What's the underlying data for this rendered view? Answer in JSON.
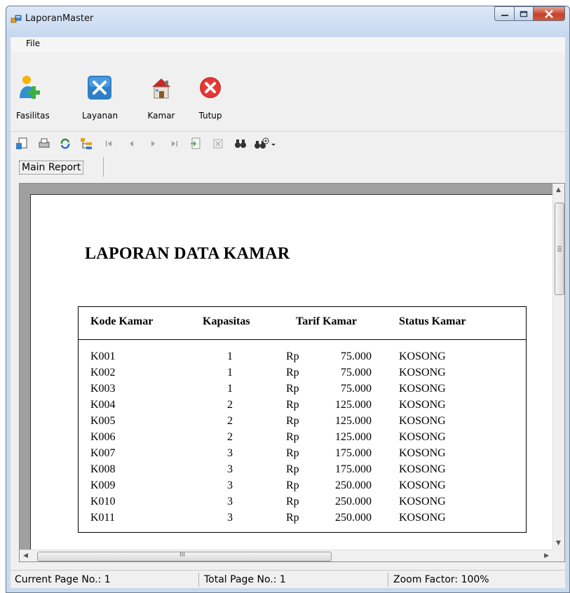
{
  "window": {
    "title": "LaporanMaster",
    "minimize": "–",
    "maximize": "□",
    "close": "✕"
  },
  "menu": {
    "file": "File"
  },
  "toolstrip": {
    "buttons": [
      {
        "label": "Fasilitas",
        "icon": "add-user-icon"
      },
      {
        "label": "Layanan",
        "icon": "tools-icon"
      },
      {
        "label": "Kamar",
        "icon": "house-icon"
      },
      {
        "label": "Tutup",
        "icon": "close-circle-icon"
      }
    ]
  },
  "viewer_toolbar": {
    "icons": [
      "export-icon",
      "print-icon",
      "refresh-icon",
      "group-tree-icon",
      "first-page-icon",
      "prev-page-icon",
      "next-page-icon",
      "last-page-icon",
      "goto-page-icon",
      "stop-icon",
      "search-icon",
      "zoom-icon"
    ]
  },
  "tab": {
    "label": "Main Report"
  },
  "report": {
    "title": "LAPORAN DATA KAMAR",
    "columns": [
      "Kode Kamar",
      "Kapasitas",
      "Tarif Kamar",
      "Status Kamar"
    ],
    "currency": "Rp",
    "rows": [
      {
        "kode": "K001",
        "kapasitas": "1",
        "tarif": "75.000",
        "status": "KOSONG"
      },
      {
        "kode": "K002",
        "kapasitas": "1",
        "tarif": "75.000",
        "status": "KOSONG"
      },
      {
        "kode": "K003",
        "kapasitas": "1",
        "tarif": "75.000",
        "status": "KOSONG"
      },
      {
        "kode": "K004",
        "kapasitas": "2",
        "tarif": "125.000",
        "status": "KOSONG"
      },
      {
        "kode": "K005",
        "kapasitas": "2",
        "tarif": "125.000",
        "status": "KOSONG"
      },
      {
        "kode": "K006",
        "kapasitas": "2",
        "tarif": "125.000",
        "status": "KOSONG"
      },
      {
        "kode": "K007",
        "kapasitas": "3",
        "tarif": "175.000",
        "status": "KOSONG"
      },
      {
        "kode": "K008",
        "kapasitas": "3",
        "tarif": "175.000",
        "status": "KOSONG"
      },
      {
        "kode": "K009",
        "kapasitas": "3",
        "tarif": "250.000",
        "status": "KOSONG"
      },
      {
        "kode": "K010",
        "kapasitas": "3",
        "tarif": "250.000",
        "status": "KOSONG"
      },
      {
        "kode": "K011",
        "kapasitas": "3",
        "tarif": "250.000",
        "status": "KOSONG"
      }
    ]
  },
  "statusbar": {
    "current_page": "Current Page No.: 1",
    "total_page": "Total Page No.: 1",
    "zoom": "Zoom Factor: 100%"
  },
  "scrollbar_grip": "III"
}
